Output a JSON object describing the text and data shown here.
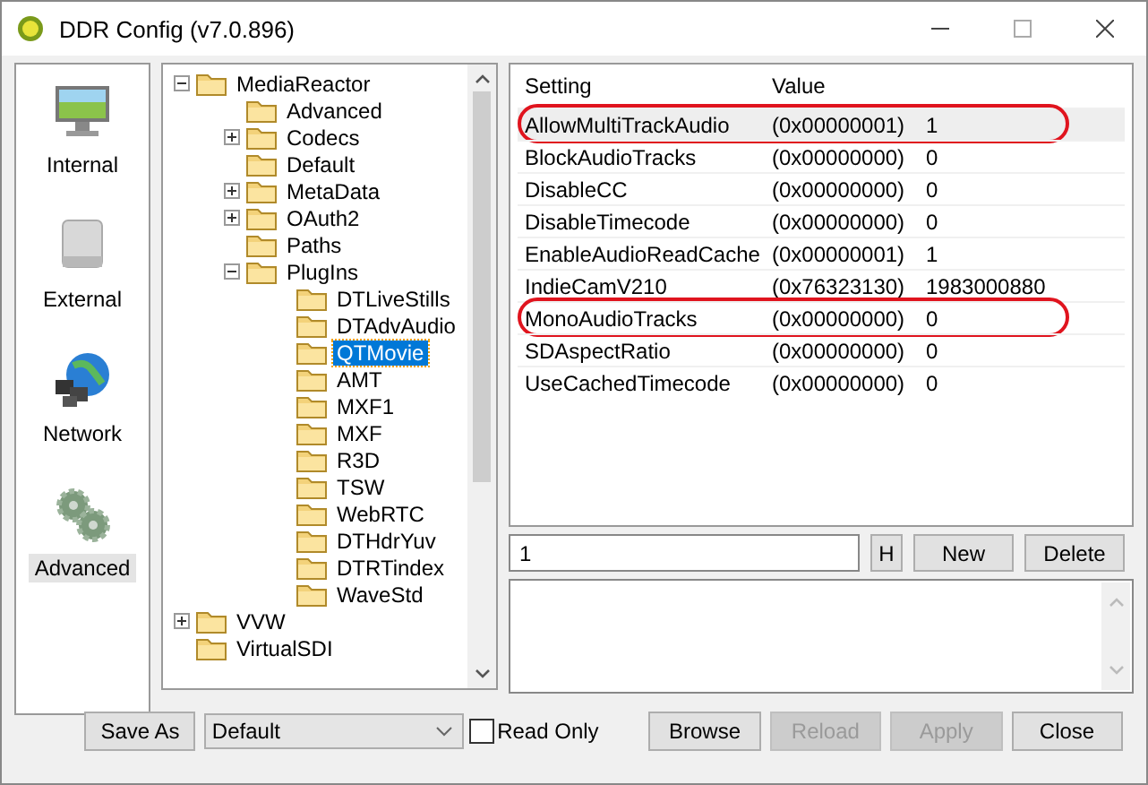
{
  "window": {
    "title": "DDR Config (v7.0.896)"
  },
  "sidebar": {
    "items": [
      {
        "label": "Internal",
        "kind": "monitor",
        "selected": false
      },
      {
        "label": "External",
        "kind": "drive",
        "selected": false
      },
      {
        "label": "Network",
        "kind": "network",
        "selected": false
      },
      {
        "label": "Advanced",
        "kind": "gears",
        "selected": true
      }
    ]
  },
  "tree": [
    {
      "label": "MediaReactor",
      "expanded": true,
      "selected": false,
      "children": [
        {
          "label": "Advanced",
          "selected": false
        },
        {
          "label": "Codecs",
          "expanded": false,
          "selected": false
        },
        {
          "label": "Default",
          "selected": false
        },
        {
          "label": "MetaData",
          "expanded": false,
          "selected": false
        },
        {
          "label": "OAuth2",
          "expanded": false,
          "selected": false
        },
        {
          "label": "Paths",
          "selected": false
        },
        {
          "label": "PlugIns",
          "expanded": true,
          "selected": false,
          "children": [
            {
              "label": "DTLiveStills",
              "selected": false
            },
            {
              "label": "DTAdvAudio",
              "selected": false
            },
            {
              "label": "QTMovie",
              "selected": true
            },
            {
              "label": "AMT",
              "selected": false
            },
            {
              "label": "MXF1",
              "selected": false
            },
            {
              "label": "MXF",
              "selected": false
            },
            {
              "label": "R3D",
              "selected": false
            },
            {
              "label": "TSW",
              "selected": false
            },
            {
              "label": "WebRTC",
              "selected": false
            },
            {
              "label": "DTHdrYuv",
              "selected": false
            },
            {
              "label": "DTRTindex",
              "selected": false
            },
            {
              "label": "WaveStd",
              "selected": false
            }
          ]
        }
      ]
    },
    {
      "label": "VVW",
      "expanded": false,
      "selected": false
    },
    {
      "label": "VirtualSDI",
      "selected": false
    }
  ],
  "table": {
    "columns": [
      "Setting",
      "Value"
    ],
    "rows": [
      {
        "setting": "AllowMultiTrackAudio",
        "hex": "(0x00000001)",
        "value": "1",
        "selected": true,
        "circled": true
      },
      {
        "setting": "BlockAudioTracks",
        "hex": "(0x00000000)",
        "value": "0",
        "selected": false,
        "circled": false
      },
      {
        "setting": "DisableCC",
        "hex": "(0x00000000)",
        "value": "0",
        "selected": false,
        "circled": false
      },
      {
        "setting": "DisableTimecode",
        "hex": "(0x00000000)",
        "value": "0",
        "selected": false,
        "circled": false
      },
      {
        "setting": "EnableAudioReadCache",
        "hex": "(0x00000001)",
        "value": "1",
        "selected": false,
        "circled": false
      },
      {
        "setting": "IndieCamV210",
        "hex": "(0x76323130)",
        "value": "1983000880",
        "selected": false,
        "circled": false
      },
      {
        "setting": "MonoAudioTracks",
        "hex": "(0x00000000)",
        "value": "0",
        "selected": false,
        "circled": true
      },
      {
        "setting": "SDAspectRatio",
        "hex": "(0x00000000)",
        "value": "0",
        "selected": false,
        "circled": false
      },
      {
        "setting": "UseCachedTimecode",
        "hex": "(0x00000000)",
        "value": "0",
        "selected": false,
        "circled": false
      }
    ]
  },
  "editor": {
    "value": "1",
    "buttons": [
      {
        "label": "H",
        "kind": "small"
      },
      {
        "label": "New",
        "kind": "normal"
      },
      {
        "label": "Delete",
        "kind": "normal"
      }
    ]
  },
  "bottom": {
    "save_as": "Save As",
    "profile": "Default",
    "read_only": {
      "label": "Read Only",
      "checked": false
    },
    "buttons": [
      {
        "label": "Browse",
        "disabled": false
      },
      {
        "label": "Reload",
        "disabled": true
      },
      {
        "label": "Apply",
        "disabled": true
      },
      {
        "label": "Close",
        "disabled": false
      }
    ]
  }
}
